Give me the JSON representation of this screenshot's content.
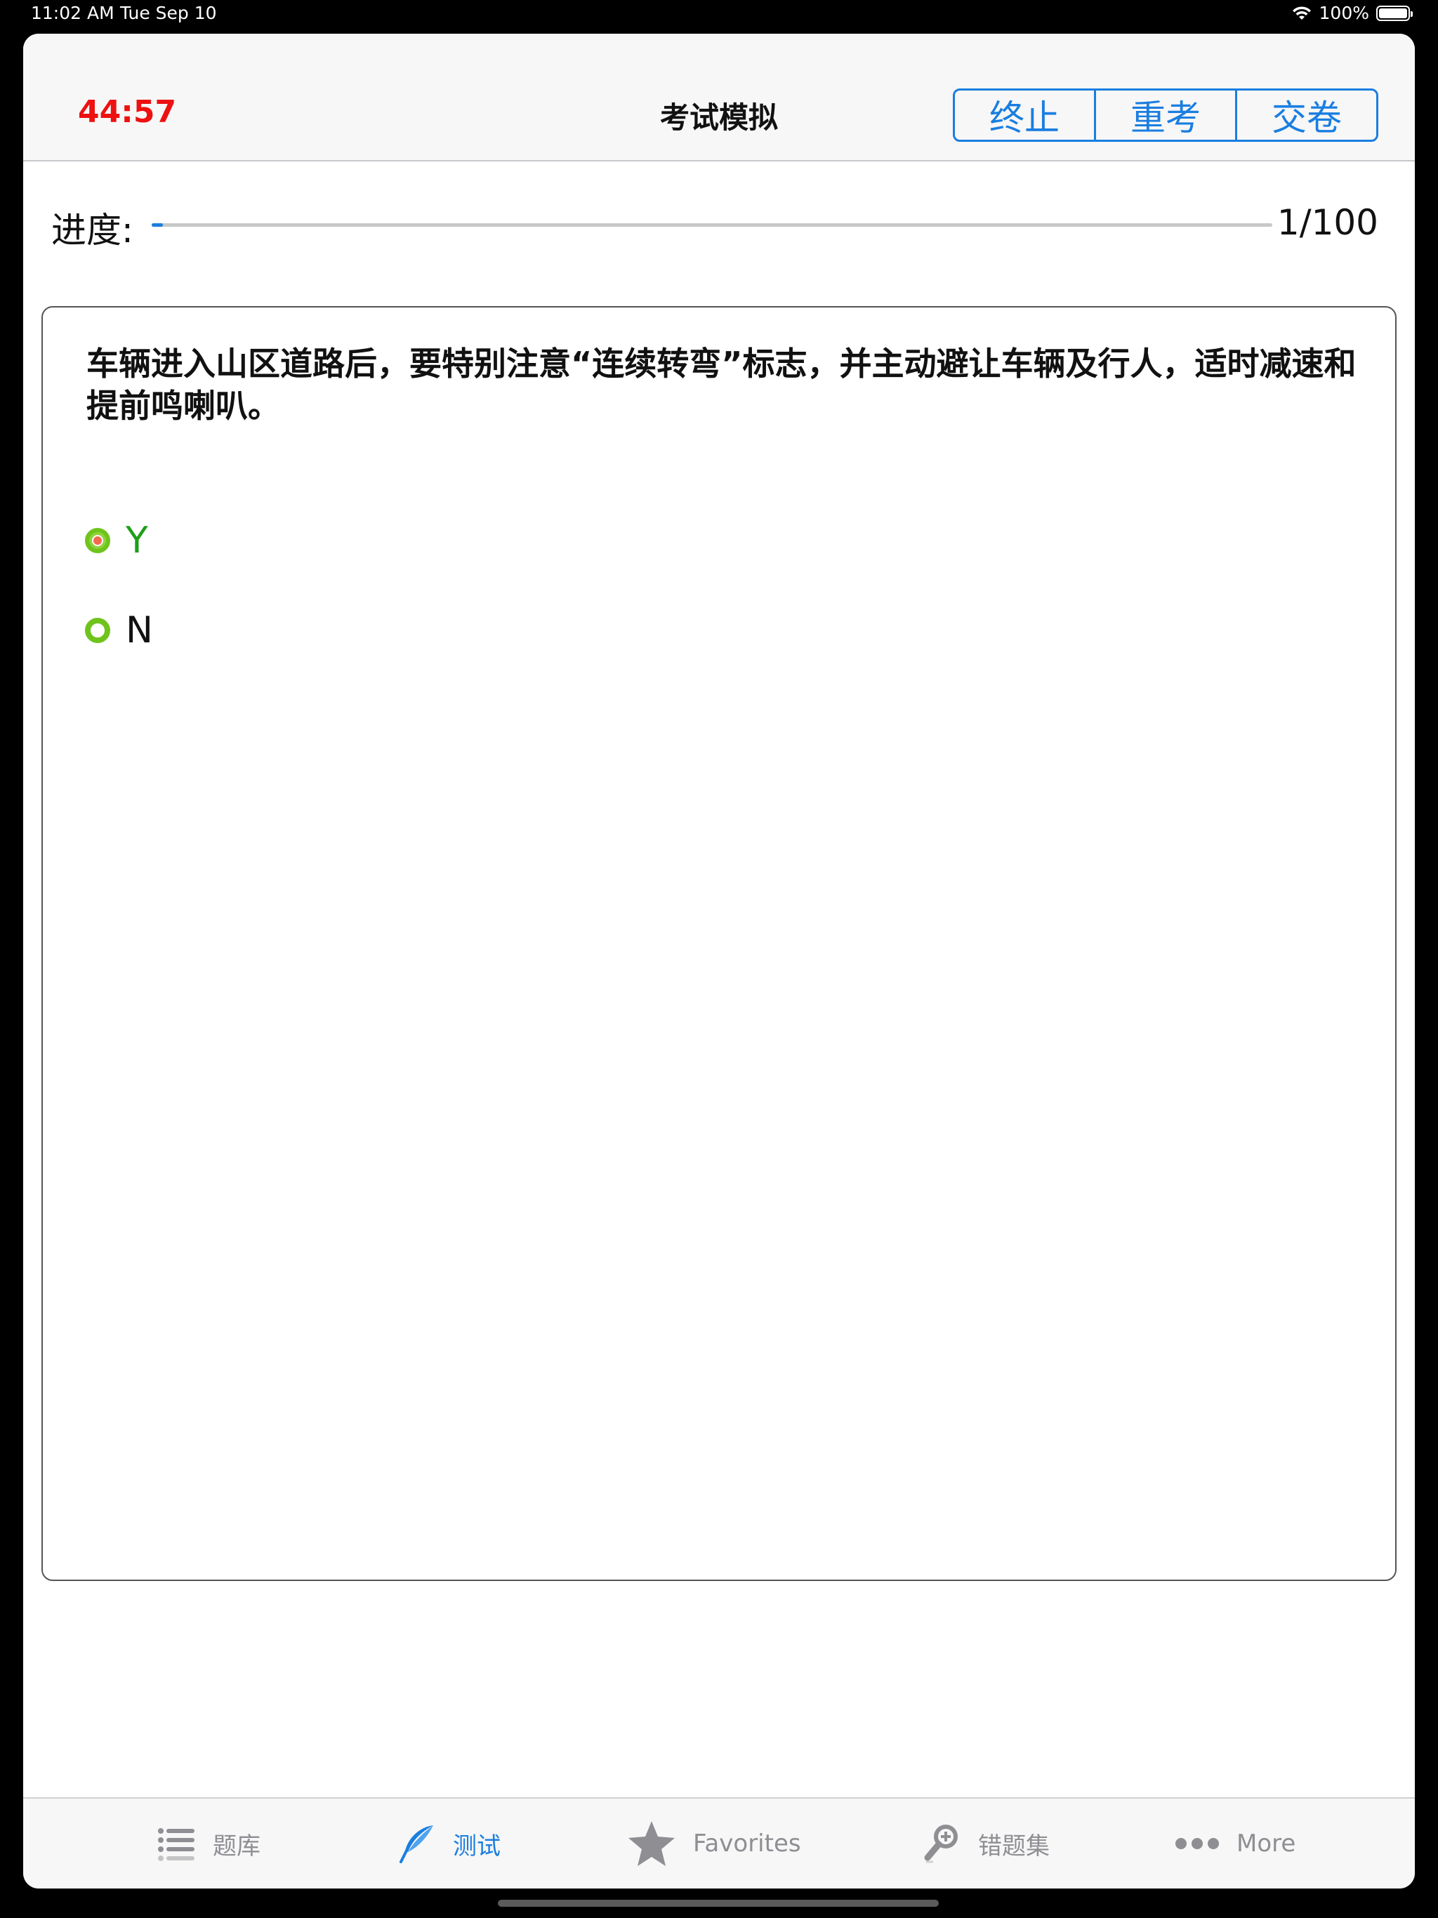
{
  "status_bar": {
    "time": "11:02 AM",
    "date": "Tue Sep 10",
    "battery": "100%",
    "battery_level": 1.0
  },
  "nav": {
    "timer": "44:57",
    "title": "考试模拟",
    "buttons": {
      "stop": "终止",
      "retake": "重考",
      "submit": "交卷"
    }
  },
  "progress": {
    "label": "进度:",
    "count": "1/100",
    "current": 1,
    "total": 100
  },
  "question": {
    "text": "车辆进入山区道路后，要特别注意“连续转弯”标志，并主动避让车辆及行人，适时减速和提前鸣喇叭。",
    "options": [
      {
        "label": "Y",
        "selected": true
      },
      {
        "label": "N",
        "selected": false
      }
    ]
  },
  "tabbar": {
    "items": [
      {
        "label": "题库",
        "icon": "list-icon"
      },
      {
        "label": "测试",
        "icon": "quill-icon",
        "active": true
      },
      {
        "label": "Favorites",
        "icon": "star-icon"
      },
      {
        "label": "错题集",
        "icon": "magnifier-plus-icon"
      },
      {
        "label": "More",
        "icon": "more-icon"
      }
    ]
  },
  "colors": {
    "accent": "#1a7ee0",
    "timer": "#ee1111",
    "radio_green": "#6fc41c",
    "selected_text": "#1e9f1a",
    "tab_inactive": "#8e8e93"
  }
}
